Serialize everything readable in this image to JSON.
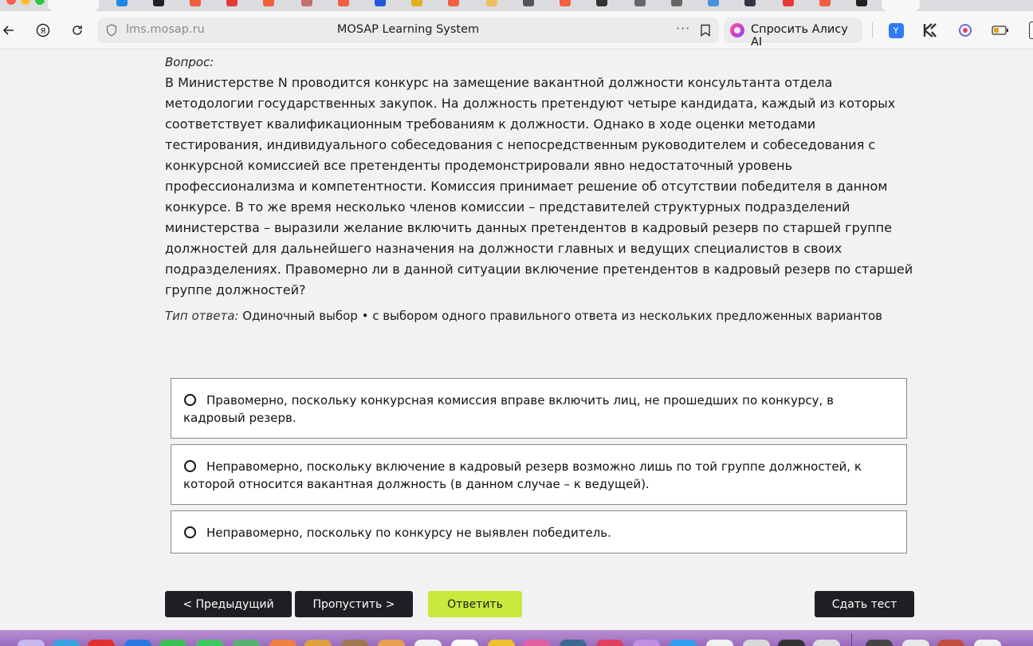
{
  "browser": {
    "url": "lms.mosap.ru",
    "page_title": "MOSAP Learning System",
    "alice_label": "Спросить Алису AI",
    "more_icon": "more-dots-icon",
    "bookmark_icon": "bookmark-icon"
  },
  "question": {
    "label": "Вопрос:",
    "text": "В Министерстве N проводится конкурс на замещение вакантной должности консультанта отдела методологии государственных закупок. На должность претендуют четыре кандидата, каждый из которых соответствует квалификационным требованиям к должности. Однако в ходе оценки методами тестирования, индивидуального собеседования с непосредственным руководителем и собеседования с конкурсной комиссией все претенденты продемонстрировали явно недостаточный уровень профессионализма и компетентности. Комиссия принимает решение об отсутствии победителя в данном конкурсе. В то же время несколько членов комиссии – представителей структурных подразделений министерства – выразили желание включить данных претендентов в кадровый резерв по старшей группе должностей для дальнейшего назначения на должности главных и ведущих специалистов в своих подразделениях. Правомерно ли в данной ситуации включение претендентов в кадровый резерв по старшей группе должностей?",
    "answer_type_label": "Тип ответа:",
    "answer_type_value": "Одиночный выбор • с выбором одного правильного ответа из нескольких предложенных вариантов"
  },
  "options": [
    "Правомерно, поскольку конкурсная комиссия вправе включить лиц, не прошедших по конкурсу, в кадровый резерв.",
    "Неправомерно, поскольку включение в кадровый резерв возможно лишь по той группе должностей, к которой относится вакантная должность (в данном случае – к ведущей).",
    "Неправомерно, поскольку по конкурсу не выявлен победитель."
  ],
  "buttons": {
    "prev": "< Предыдущий",
    "skip": "Пропустить >",
    "answer": "Ответить",
    "submit": "Сдать тест"
  },
  "colors": {
    "accent_lime": "#c8ea3c",
    "button_dark": "#1d1f22"
  }
}
